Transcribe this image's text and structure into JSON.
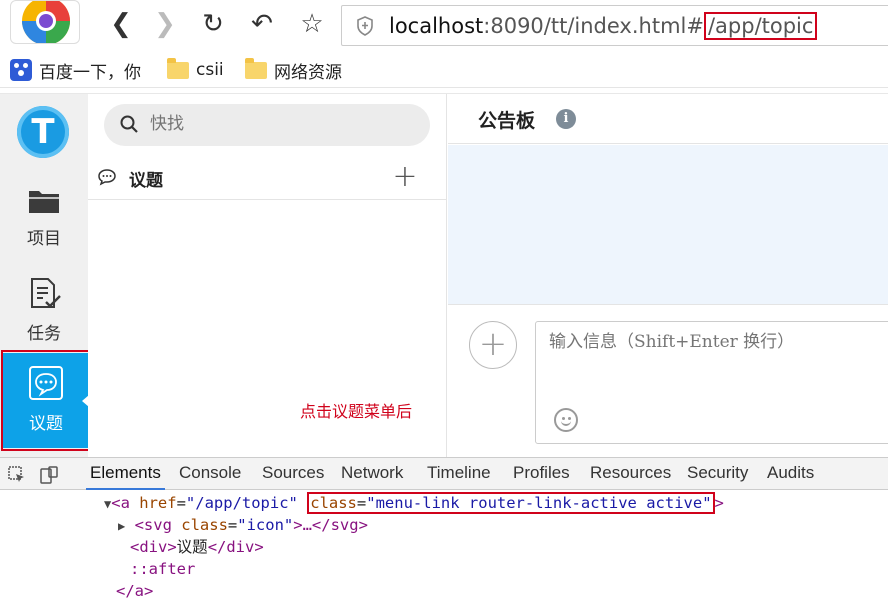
{
  "browser": {
    "url_host": "localhost",
    "url_path": ":8090/tt/index.html#",
    "url_highlight": "/app/topic"
  },
  "bookmarks": [
    {
      "label": "百度一下，你",
      "icon": "baidu-paw-icon"
    },
    {
      "label": "csii",
      "icon": "folder-icon"
    },
    {
      "label": "网络资源",
      "icon": "folder-icon"
    }
  ],
  "app": {
    "logo_letter": "T",
    "rail": [
      {
        "label": "项目",
        "icon": "folder-icon"
      },
      {
        "label": "任务",
        "icon": "task-icon"
      },
      {
        "label": "议题",
        "icon": "topic-chat-icon",
        "active": true
      }
    ],
    "search_placeholder": "快找",
    "list_title": "议题",
    "annotation": "点击议题菜单后",
    "main_title": "公告板",
    "message_placeholder": "输入信息（Shift+Enter 换行）"
  },
  "devtools": {
    "tabs": [
      "Elements",
      "Console",
      "Sources",
      "Network",
      "Timeline",
      "Profiles",
      "Resources",
      "Security",
      "Audits"
    ],
    "active_tab": "Elements",
    "code": {
      "line1_tag_open": "<a ",
      "line1_href_attr": "href",
      "line1_href_val": "\"/app/topic\"",
      "line1_class_attr": "class",
      "line1_class_val": "\"menu-link router-link-active active\"",
      "line1_close": ">",
      "line2_open": "<svg ",
      "line2_attr": "class",
      "line2_val": "\"icon\"",
      "line2_rest": ">…</svg>",
      "line3_open": "<div>",
      "line3_text": "议题",
      "line3_close": "</div>",
      "line4": "::after",
      "line5": "</a>"
    }
  },
  "colors": {
    "accent": "#0da2e8",
    "highlight_red": "#d0021b",
    "board_bg": "#eef5fd"
  }
}
